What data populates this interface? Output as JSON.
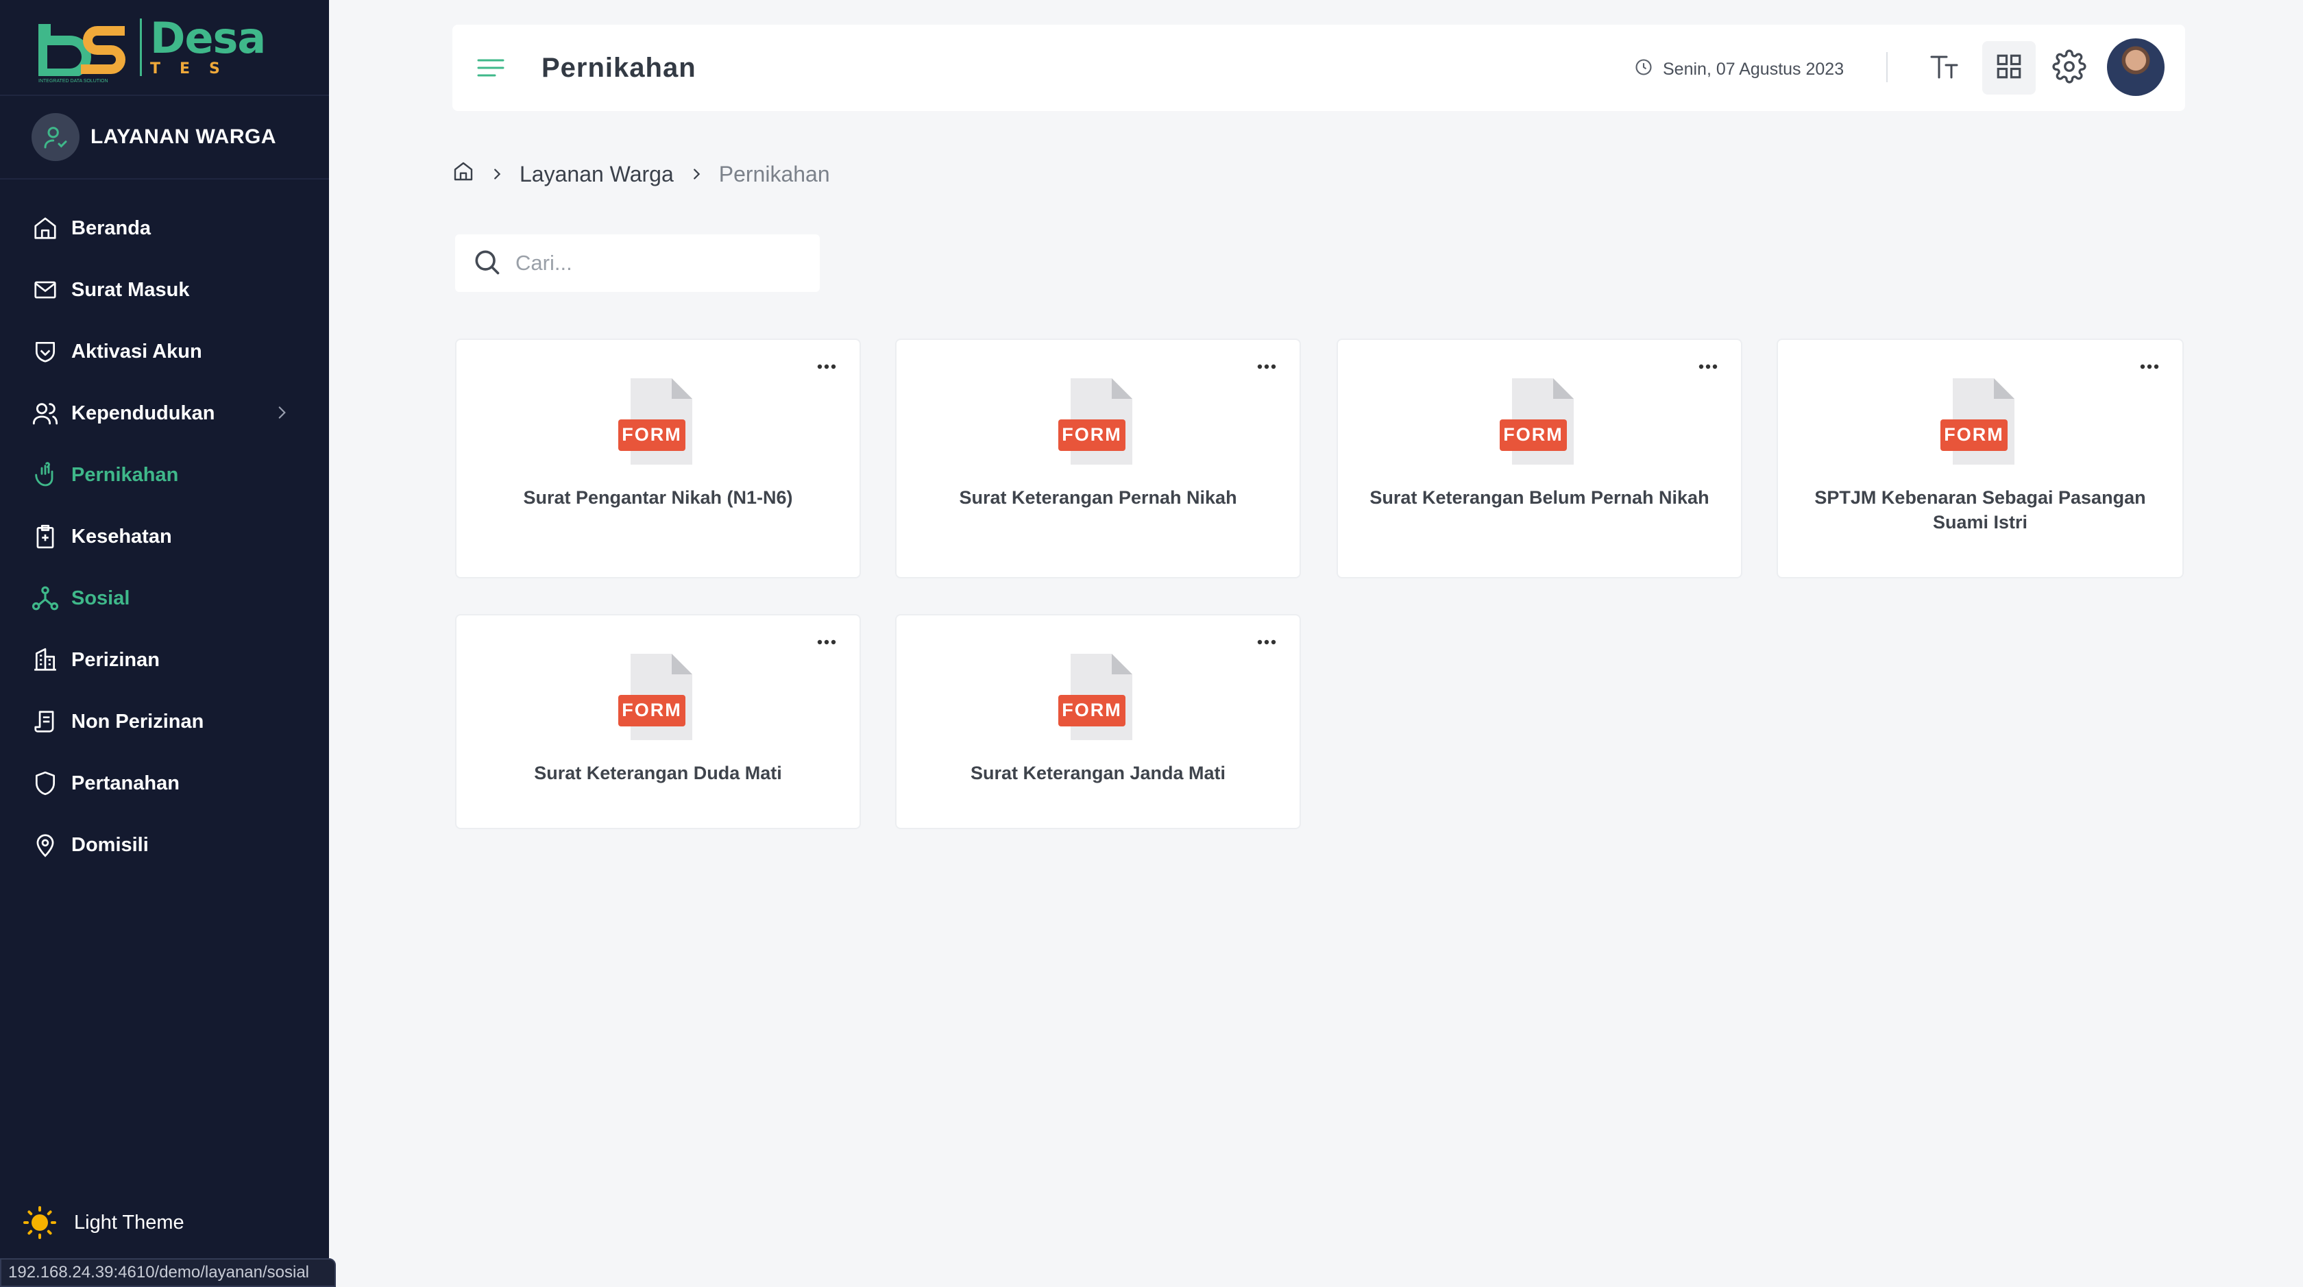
{
  "app": {
    "logo_letters": "DS",
    "logo_tagline": "INTEGRATED DATA SOLUTION",
    "brand_top": "Desa",
    "brand_bottom": "TES"
  },
  "sidebar": {
    "user_label": "LAYANAN WARGA",
    "items": [
      {
        "label": "Beranda",
        "icon": "home-icon"
      },
      {
        "label": "Surat Masuk",
        "icon": "mail-icon"
      },
      {
        "label": "Aktivasi Akun",
        "icon": "shield-check-icon"
      },
      {
        "label": "Kependudukan",
        "icon": "users-icon"
      },
      {
        "label": "Pernikahan",
        "icon": "heart-hand-icon",
        "active": true
      },
      {
        "label": "Kesehatan",
        "icon": "clipboard-plus-icon"
      },
      {
        "label": "Sosial",
        "icon": "network-icon",
        "active": true
      },
      {
        "label": "Perizinan",
        "icon": "building-icon"
      },
      {
        "label": "Non Perizinan",
        "icon": "document-icon"
      },
      {
        "label": "Pertanahan",
        "icon": "shield-icon"
      },
      {
        "label": "Domisili",
        "icon": "location-icon"
      }
    ],
    "theme_label": "Light Theme"
  },
  "status_bar_url": "192.168.24.39:4610/demo/layanan/sosial",
  "header": {
    "title": "Pernikahan",
    "date": "Senin, 07 Agustus 2023"
  },
  "breadcrumb": {
    "items": [
      "Layanan Warga",
      "Pernikahan"
    ]
  },
  "search": {
    "placeholder": "Cari..."
  },
  "form_badge": "FORM",
  "cards": [
    {
      "title": "Surat Pengantar Nikah (N1-N6)"
    },
    {
      "title": "Surat Keterangan Pernah Nikah"
    },
    {
      "title": "Surat Keterangan Belum Pernah Nikah"
    },
    {
      "title": "SPTJM Kebenaran Sebagai Pasangan Suami Istri"
    },
    {
      "title": "Surat Keterangan Duda Mati"
    },
    {
      "title": "Surat Keterangan Janda Mati"
    }
  ],
  "colors": {
    "sidebar_bg": "#141a2f",
    "accent_green": "#3fb88a",
    "accent_orange": "#f0a93a",
    "form_badge": "#e8553a"
  }
}
